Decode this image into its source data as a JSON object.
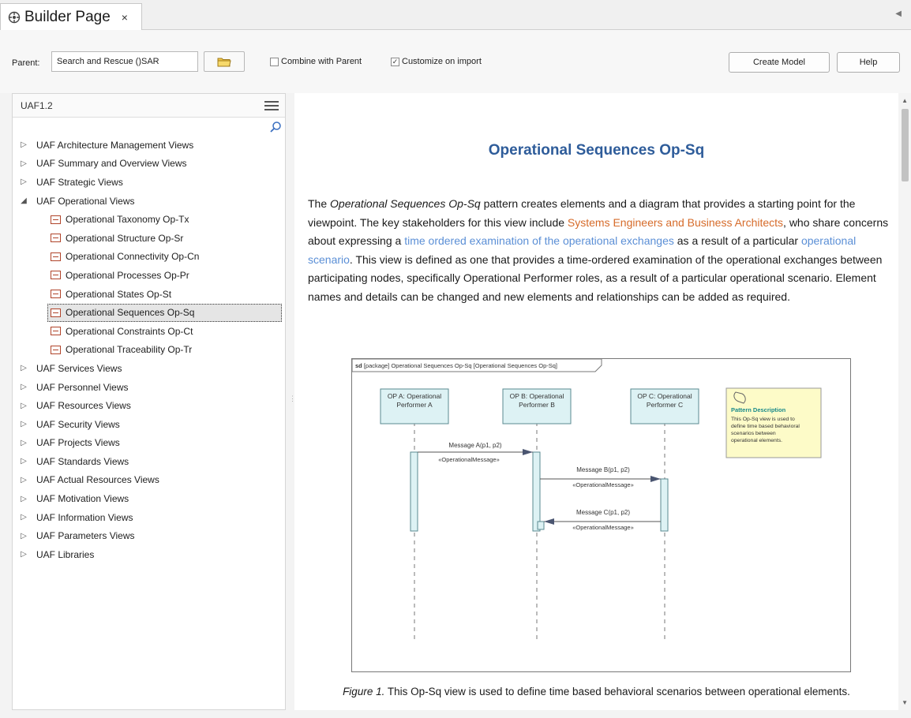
{
  "tab": {
    "title": "Builder Page",
    "close": "×"
  },
  "toolbar": {
    "parent_label": "Parent:",
    "parent_value": "Search and Rescue ()SAR",
    "combine_label": "Combine with Parent",
    "combine_checked": false,
    "customize_label": "Customize on import",
    "customize_checked": true,
    "create_model": "Create Model",
    "help": "Help"
  },
  "tree": {
    "header": "UAF1.2",
    "items": [
      {
        "label": "UAF Architecture Management Views",
        "expanded": false
      },
      {
        "label": "UAF Summary and Overview Views",
        "expanded": false
      },
      {
        "label": "UAF Strategic Views",
        "expanded": false
      },
      {
        "label": "UAF Operational Views",
        "expanded": true
      },
      {
        "label": "Operational Taxonomy Op-Tx",
        "child": true
      },
      {
        "label": "Operational Structure Op-Sr",
        "child": true
      },
      {
        "label": "Operational Connectivity Op-Cn",
        "child": true
      },
      {
        "label": "Operational Processes Op-Pr",
        "child": true
      },
      {
        "label": "Operational States Op-St",
        "child": true
      },
      {
        "label": "Operational Sequences Op-Sq",
        "child": true,
        "selected": true
      },
      {
        "label": "Operational Constraints Op-Ct",
        "child": true
      },
      {
        "label": "Operational Traceability Op-Tr",
        "child": true
      },
      {
        "label": "UAF Services Views",
        "expanded": false
      },
      {
        "label": "UAF Personnel Views",
        "expanded": false
      },
      {
        "label": "UAF Resources Views",
        "expanded": false
      },
      {
        "label": "UAF Security Views",
        "expanded": false
      },
      {
        "label": "UAF Projects Views",
        "expanded": false
      },
      {
        "label": "UAF Standards Views",
        "expanded": false
      },
      {
        "label": "UAF Actual Resources Views",
        "expanded": false
      },
      {
        "label": "UAF Motivation Views",
        "expanded": false
      },
      {
        "label": "UAF Information Views",
        "expanded": false
      },
      {
        "label": "UAF Parameters Views",
        "expanded": false
      },
      {
        "label": "UAF Libraries",
        "expanded": false
      }
    ]
  },
  "content": {
    "heading": "Operational Sequences Op-Sq",
    "p_the": "The ",
    "p_italic": "Operational Sequences Op-Sq",
    "p_part1": " pattern creates elements and a diagram that provides a starting point for the viewpoint. The key stakeholders for this view include ",
    "p_stakeholders": "Systems Engineers and Business Architects",
    "p_part2": ", who share concerns about expressing a ",
    "p_concern": "time ordered examination of the operational exchanges",
    "p_part3": " as a result of a particular ",
    "p_scenario": "operational scenario",
    "p_part4": ". This view is defined as one that provides a time-ordered examination of the operational exchanges between participating nodes, specifically Operational Performer roles, as a result of a particular operational scenario. Element names and details can be changed and new elements and relationships can be added as required.",
    "caption_fig": "Figure 1.",
    "caption_text": " This Op-Sq view is used to define time based behavioral scenarios between operational elements."
  },
  "diagram": {
    "frame_label_bold": "sd",
    "frame_label": " [package] Operational Sequences Op-Sq [Operational Sequences Op-Sq]",
    "lifelines": [
      {
        "line1": "OP A: Operational",
        "line2": "Performer A"
      },
      {
        "line1": "OP B: Operational",
        "line2": "Performer B"
      },
      {
        "line1": "OP C: Operational",
        "line2": "Performer C"
      }
    ],
    "messages": [
      {
        "label": "Message A(p1, p2)",
        "stereotype": "«OperationalMessage»"
      },
      {
        "label": "Message B(p1, p2)",
        "stereotype": "«OperationalMessage»"
      },
      {
        "label": "Message C(p1, p2)",
        "stereotype": "«OperationalMessage»"
      }
    ],
    "note": {
      "title": "Pattern Description",
      "lines": [
        "This Op-Sq view is used to",
        "define time based behavioral",
        "scenarios between",
        "operational elements."
      ]
    },
    "colors": {
      "lifeline_fill": "#ddf2f4",
      "lifeline_border": "#5a8a90",
      "note_fill": "#fdfbc8",
      "note_title": "#1a8a8a"
    }
  }
}
